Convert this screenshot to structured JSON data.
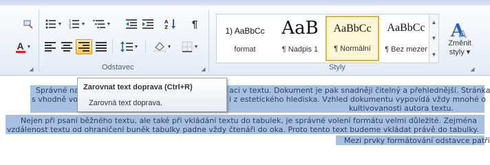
{
  "ribbon": {
    "paragraph_group_label": "Odstavec",
    "styles_group_label": "Styly",
    "buttons": {
      "bullets": "bullets-icon",
      "numbering": "numbering-icon",
      "multilevel": "multilevel-list-icon",
      "decrease_indent": "decrease-indent-icon",
      "increase_indent": "increase-indent-icon",
      "sort": "sort-icon",
      "show_marks": "¶",
      "align_left": "align-left-icon",
      "align_center": "align-center-icon",
      "align_right": "align-right-icon",
      "justify": "justify-icon",
      "line_spacing": "line-spacing-icon",
      "shading": "shading-icon",
      "borders": "borders-icon",
      "font_color": "A"
    },
    "styles": [
      {
        "sample": "1) AaBbCc",
        "name": "format",
        "selected": false
      },
      {
        "sample": "AaB",
        "name": "¶ Nadpis 1",
        "selected": false
      },
      {
        "sample": "AaBbCc",
        "name": "¶ Normální",
        "selected": true
      },
      {
        "sample": "AaBbCc",
        "name": "¶ Bez mezer",
        "selected": false
      }
    ],
    "change_styles": {
      "line1": "Změnit",
      "line2": "styly ▾"
    },
    "colors": {
      "active_bg": "#f7c74f",
      "selection": "#a8bfe0",
      "font_color_bar": "#e02020"
    }
  },
  "tooltip": {
    "title": "Zarovnat text doprava (Ctrl+R)",
    "description": "Zarovná text doprava."
  },
  "document": {
    "lines": [
      {
        "left": "Správné na",
        "right": "aci v textu. Dokument je pak snadněji čitelný a přehlednější. Stránka"
      },
      {
        "left": "s vhodně vo",
        "right": "i z estetického hlediska. Vzhled dokumentu vypovídá vždy mnohé o"
      },
      {
        "text": "kultivovanosti autora textu."
      },
      {
        "text": "Nejen při psaní běžného textu, ale také při vkládání textu do tabulek, je správné volení formátu velmi důležité. Zejména"
      },
      {
        "text": "vzdálenost textu od ohraničení buněk tabulky padne vždy čtenáři do oka. Proto tento text budeme vkládat právě do tabulky."
      },
      {
        "text": "Mezi prvky formátování odstavce patří:"
      }
    ]
  }
}
